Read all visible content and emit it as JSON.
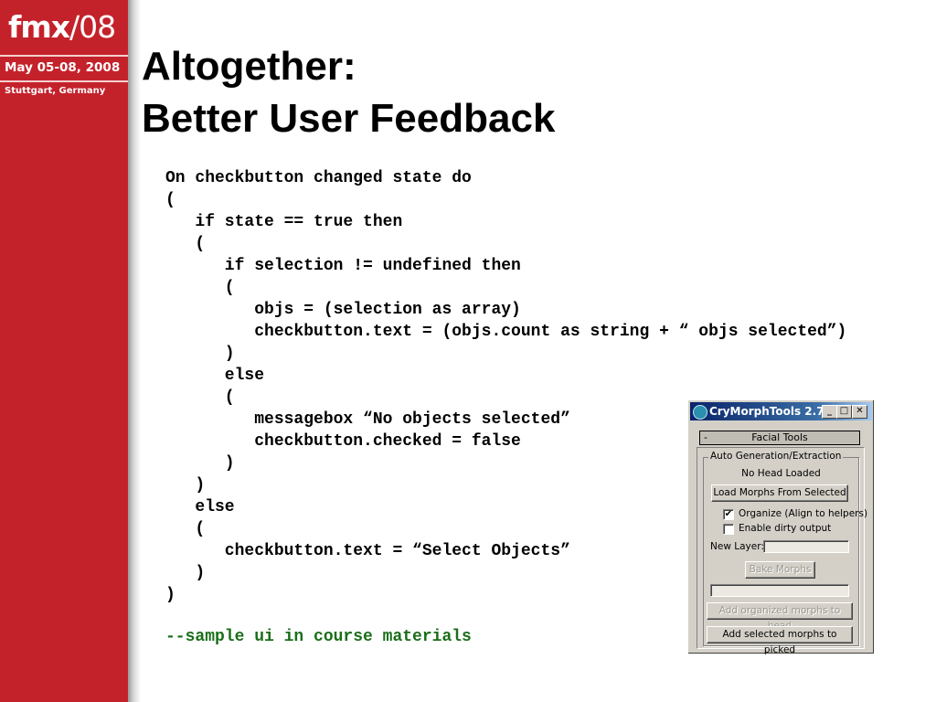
{
  "sidebar": {
    "logo_brand": "fmx",
    "logo_year": "/08",
    "dates": "May 05-08, 2008",
    "location": "Stuttgart, Germany",
    "color": "#c4222b"
  },
  "slide": {
    "title_line1": "Altogether:",
    "title_line2": "Better User Feedback",
    "code_lines": [
      "On checkbutton changed state do",
      "(",
      "   if state == true then",
      "   (",
      "      if selection != undefined then",
      "      (",
      "         objs = (selection as array)",
      "         checkbutton.text = (objs.count as string + “ objs selected”)",
      "      )",
      "      else",
      "      (",
      "         messagebox “No objects selected”",
      "         checkbutton.checked = false",
      "      )",
      "   )",
      "   else",
      "   (",
      "      checkbutton.text = “Select Objects”",
      "   )",
      ")"
    ],
    "comment": "--sample ui in course materials",
    "comment_color": "#1a6e1a"
  },
  "window": {
    "title": "CryMorphTools 2.7",
    "minimize_glyph": "_",
    "maximize_glyph": "□",
    "close_glyph": "✕",
    "rollout_toggle": "-",
    "rollout_title": "Facial Tools",
    "group_label": "Auto Generation/Extraction",
    "status": "No Head Loaded",
    "load_button": "Load Morphs From Selected",
    "organize_checkbox": {
      "label": "Organize (Align to helpers)",
      "checked": true,
      "mark": "✔"
    },
    "dirty_checkbox": {
      "label": "Enable dirty output",
      "checked": false,
      "mark": ""
    },
    "new_layer_label": "New Layer:",
    "new_layer_value": "",
    "bake_button": "Bake Morphs",
    "progress": 0,
    "add_organized_button": "Add organized morphs to head",
    "add_selected_button": "Add selected morphs to picked"
  }
}
